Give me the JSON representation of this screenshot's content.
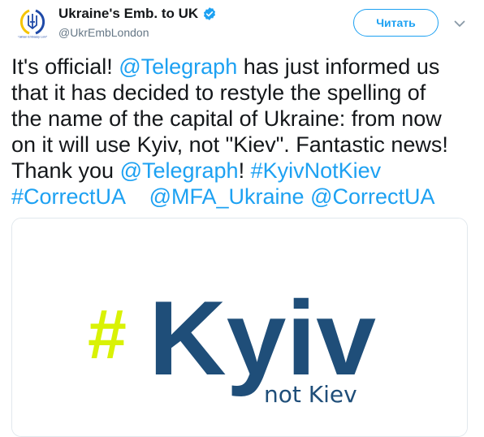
{
  "author": {
    "display_name": "Ukraine's Emb. to UK",
    "handle": "@UkrEmbLondon",
    "avatar_caption": "Ukrainian Embassy London"
  },
  "follow_button": {
    "label": "Читать"
  },
  "tweet": {
    "lines": [
      [
        {
          "t": "It's official! "
        },
        {
          "t": "@Telegraph",
          "link": true
        },
        {
          "t": " has just informed us"
        }
      ],
      [
        {
          "t": "that it has decided to restyle the spelling of"
        }
      ],
      [
        {
          "t": "the name of the capital of Ukraine: from now"
        }
      ],
      [
        {
          "t": "on it will use Kyiv, not \"Kiev\". Fantastic news!"
        }
      ],
      [
        {
          "t": "Thank you "
        },
        {
          "t": "@Telegraph",
          "link": true
        },
        {
          "t": "! "
        },
        {
          "t": "#KyivNotKiev",
          "link": true
        }
      ],
      [
        {
          "t": "#CorrectUA",
          "link": true
        },
        {
          "t": "    "
        },
        {
          "t": "@MFA_Ukraine",
          "link": true
        },
        {
          "t": " "
        },
        {
          "t": "@CorrectUA",
          "link": true
        }
      ]
    ]
  },
  "card": {
    "hash": "#",
    "main_word": "Kyiv",
    "sub_text": "not Kiev"
  },
  "colors": {
    "link": "#1da1f2",
    "hash_yellow": "#d9f205",
    "kyiv_blue": "#1f4e79",
    "verified": "#1da1f2"
  }
}
